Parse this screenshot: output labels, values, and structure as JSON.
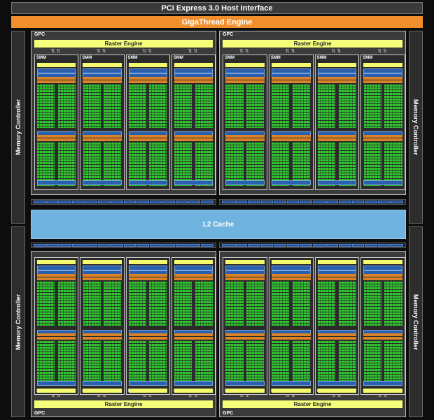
{
  "header": {
    "pci_label": "PCI Express 3.0 Host Interface",
    "giga_label": "GigaThread Engine"
  },
  "memory_controller_label": "Memory Controller",
  "l2_label": "L2 Cache",
  "gpc": {
    "label": "GPC",
    "raster_label": "Raster Engine",
    "smm_label": "SMM"
  },
  "colors": {
    "background": "#0d0d0d",
    "giga_orange": "#f08f2c",
    "raster_yellow": "#f6ff7a",
    "cuda_core_green": "#2ecc2e",
    "l2_blue": "#6fb3df",
    "unit_blue": "#2a5fae"
  },
  "icons": {
    "smm_arrows": "double-arrow-icon"
  }
}
